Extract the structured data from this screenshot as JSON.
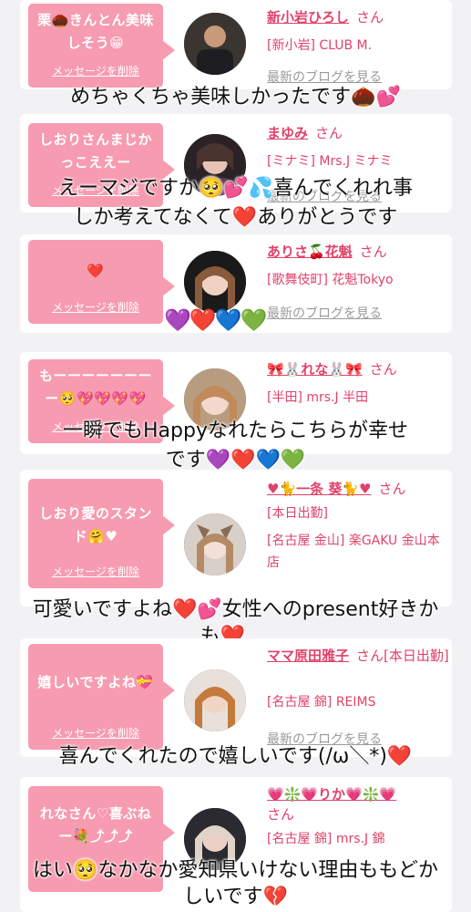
{
  "cards": [
    {
      "bubble": "栗🌰きんとん美味しそう😁",
      "delete_label": "メッセージを削除",
      "name": "新小岩ひろし",
      "san": "さん",
      "shop": "[新小岩] CLUB M.",
      "blog_label": "最新のブログを見る",
      "reply": "めちゃくちゃ美味しかったです🌰💕"
    },
    {
      "bubble": "しおりさんまじかっこええー",
      "delete_label": "メッセージを削除",
      "name": "まゆみ",
      "san": "さん",
      "shop": "[ミナミ] Mrs.J ミナミ",
      "blog_label": "最新のブログを見る",
      "reply_line1": "えーマジですか🥺💕💦喜んでくれれ事",
      "reply_line2": "しか考えてなくて❤️ありがとうです"
    },
    {
      "bubble": "❤️",
      "delete_label": "メッセージを削除",
      "name": "ありさ🍒花魁",
      "san": "さん",
      "shop": "[歌舞伎町] 花魁Tokyo",
      "blog_label": "最新のブログを見る",
      "reply": "💜❤️💙💚"
    },
    {
      "bubble": "もーーーーーーーー🥺💖💖💖💖",
      "delete_label": "メッセージを削除",
      "name": "🎀🐰れな🐰🎀",
      "san": "さん",
      "shop": "[半田] mrs.J 半田",
      "blog_label": "最新のブログを見る",
      "reply_line1": "一瞬でもHappyなれたらこちらが幸せ",
      "reply_line2": "です💜❤️💙💚"
    },
    {
      "bubble": "しおり愛のスタンド🤗♥",
      "delete_label": "メッセージを削除",
      "name": "♥🐈一条 葵🐈♥",
      "san": "さん",
      "status": "[本日出勤]",
      "shop": "[名古屋 金山] 楽GAKU 金山本店",
      "blog_label": "最新のブログを見る",
      "reply_line1": "可愛いですよね❤️💕女性へのpresent好きか",
      "reply_line2": "も❤️"
    },
    {
      "bubble": "嬉しいですよね💝",
      "delete_label": "メッセージを削除",
      "name": "ママ原田雅子",
      "san": "さん[本日出勤]",
      "shop": "[名古屋 錦] REIMS",
      "blog_label": "最新のブログを見る",
      "reply": "喜んでくれたので嬉しいです(/ω＼*)❤️"
    },
    {
      "bubble": "れなさん♡喜ぶねー💐⤴⤴⤴",
      "delete_label": "メッセージを削除",
      "name": "💗❇️💗りか💗❇️💗",
      "san": "さん",
      "shop": "[名古屋 錦] mrs.J 錦",
      "blog_label": "最新のブログを見る",
      "reply_line1": "はい🥺なかなか愛知県いけない理由ももどか",
      "reply_line2": "しいです💔"
    }
  ],
  "colors": {
    "accent": "#e0426a",
    "bubble": "#f79bb0",
    "muted": "#9a9a9a"
  }
}
